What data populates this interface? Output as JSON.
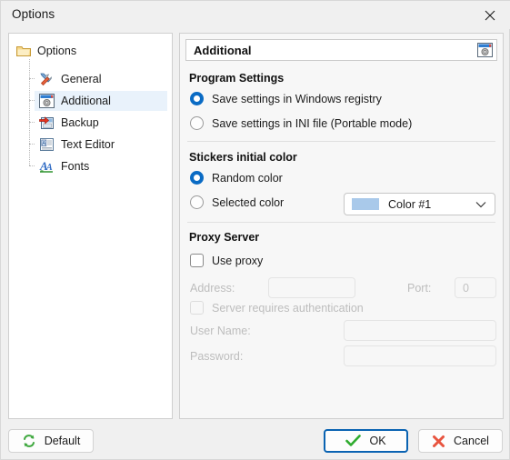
{
  "window": {
    "title": "Options",
    "close_icon": "close-icon"
  },
  "sidebar": {
    "root": {
      "label": "Options",
      "icon": "folder-icon"
    },
    "items": [
      {
        "label": "General",
        "icon": "tools-icon",
        "selected": false
      },
      {
        "label": "Additional",
        "icon": "window-gear-icon",
        "selected": true
      },
      {
        "label": "Backup",
        "icon": "floppy-arrow-icon",
        "selected": false
      },
      {
        "label": "Text Editor",
        "icon": "document-a-icon",
        "selected": false
      },
      {
        "label": "Fonts",
        "icon": "font-a-icon",
        "selected": false
      }
    ]
  },
  "page": {
    "header_title": "Additional",
    "header_icon": "window-gear-icon",
    "groups": {
      "program_settings": {
        "title": "Program Settings",
        "options": [
          {
            "label": "Save settings in Windows registry",
            "checked": true
          },
          {
            "label": "Save settings in INI file (Portable mode)",
            "checked": false
          }
        ]
      },
      "stickers_color": {
        "title": "Stickers initial color",
        "options": [
          {
            "label": "Random color",
            "checked": true
          },
          {
            "label": "Selected color",
            "checked": false
          }
        ],
        "combo": {
          "value": "Color #1",
          "swatch_color": "#a9c9ea",
          "arrow_icon": "chevron-down-icon"
        }
      },
      "proxy_server": {
        "title": "Proxy Server",
        "use_proxy": {
          "label": "Use proxy",
          "checked": false
        },
        "address_label": "Address:",
        "address_value": "",
        "port_label": "Port:",
        "port_value": "0",
        "auth": {
          "label": "Server requires authentication",
          "checked": false
        },
        "username_label": "User Name:",
        "username_value": "",
        "password_label": "Password:",
        "password_value": ""
      }
    }
  },
  "footer": {
    "default_button": {
      "label": "Default",
      "icon": "refresh-icon"
    },
    "ok_button": {
      "label": "OK",
      "icon": "check-icon"
    },
    "cancel_button": {
      "label": "Cancel",
      "icon": "x-icon"
    }
  },
  "colors": {
    "accent": "#0a6bc4",
    "accent_border": "#0a63b2",
    "selection_bg": "#e9f2fb",
    "swatch": "#a9c9ea",
    "ok_check": "#2eab2e",
    "cancel_x": "#e8543f"
  }
}
